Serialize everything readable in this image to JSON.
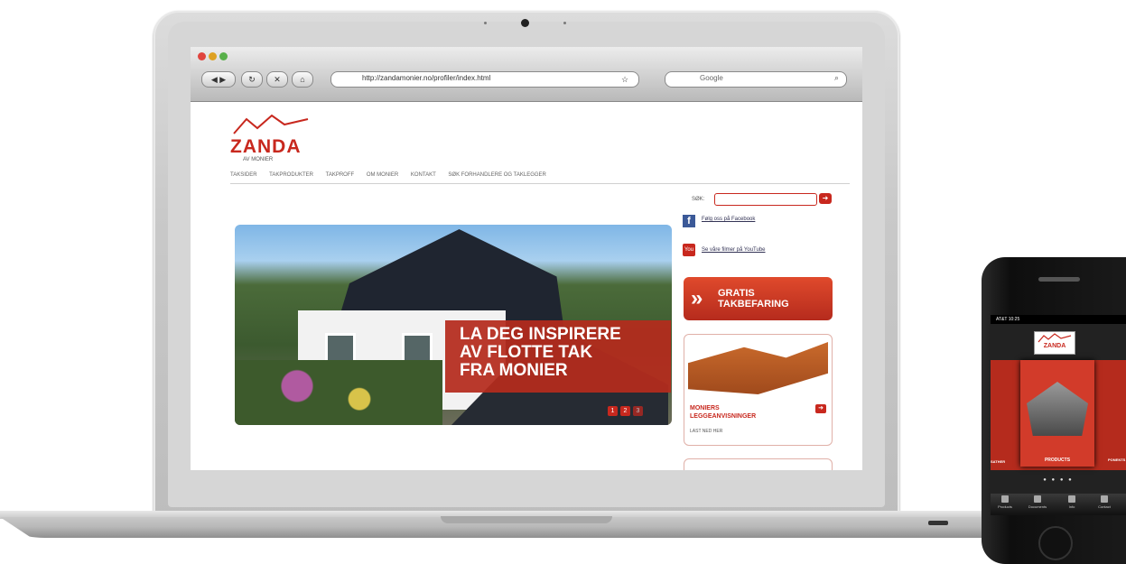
{
  "browser": {
    "url": "http://zandamonier.no/profiler/index.html",
    "search_placeholder": "Google"
  },
  "site": {
    "logo_name": "ZANDA",
    "logo_sub": "AV MONIER",
    "nav": [
      "TAKSIDER",
      "TAKPRODUKTER",
      "TAKPROFF",
      "OM MONIER",
      "KONTAKT",
      "SØK FORHANDLERE OG TAKLEGGER"
    ],
    "search_label": "SØK:",
    "hero_text": "LA DEG INSPIRERE\nAV FLOTTE TAK\nFRA MONIER",
    "hero_dots": [
      "1",
      "2",
      "3"
    ],
    "facebook_link": "Følg oss på Facebook",
    "youtube_link": "Se våre filmer på YouTube",
    "gratis_text": "GRATIS\nTAKBEFARING",
    "card_title": "MONIERS\nLEGGEANVISNINGER",
    "card_sub": "LAST NED HER"
  },
  "phone": {
    "status": "AT&T   10:25",
    "logo": "ZANDA",
    "products_label": "PRODUCTS",
    "left_label": "SATHER",
    "right_label": "PONENTS",
    "pager": "● ● ● ●",
    "tabs": [
      "Products",
      "Documents",
      "Info",
      "Contact"
    ]
  },
  "colors": {
    "brand_red": "#c8281e",
    "facebook_blue": "#3b5998"
  }
}
